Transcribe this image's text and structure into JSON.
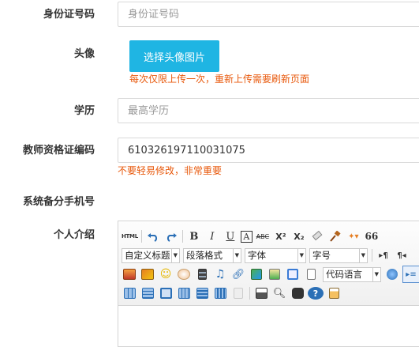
{
  "form": {
    "id_card": {
      "label": "身份证号码",
      "placeholder": "身份证号码"
    },
    "avatar": {
      "label": "头像",
      "button": "选择头像图片",
      "hint": "每次仅限上传一次，重新上传需要刷新页面"
    },
    "education": {
      "label": "学历",
      "placeholder": "最高学历"
    },
    "teacher_cert": {
      "label": "教师资格证编码",
      "value": "610326197110031075",
      "hint": "不要轻易修改，非常重要"
    },
    "backup_phone": {
      "label": "系统备分手机号"
    },
    "intro": {
      "label": "个人介绍"
    }
  },
  "editor": {
    "html_label": "HTML",
    "bold": "B",
    "italic": "I",
    "underline": "U",
    "font_border": "A",
    "strike": "ABC",
    "superscript": "X²",
    "subscript": "X₂",
    "quote": "66",
    "paragraph_ltr": "▸¶",
    "paragraph_rtl": "¶◂",
    "selects": {
      "custom_title": "自定义标题",
      "paragraph_format": "段落格式",
      "font_family": "字体",
      "font_size": "字号",
      "code_language": "代码语言"
    }
  }
}
